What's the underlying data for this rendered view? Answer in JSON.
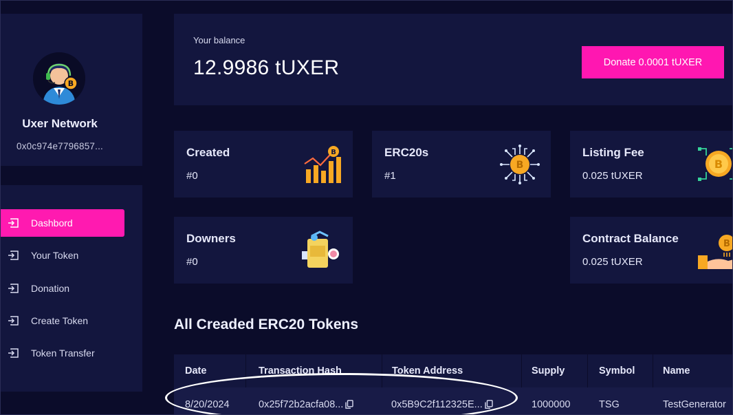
{
  "profile": {
    "name": "Uxer Network",
    "address": "0x0c974e7796857..."
  },
  "nav": {
    "items": [
      {
        "label": "Dashbord",
        "active": true
      },
      {
        "label": "Your Token",
        "active": false
      },
      {
        "label": "Donation",
        "active": false
      },
      {
        "label": "Create Token",
        "active": false
      },
      {
        "label": "Token Transfer",
        "active": false
      }
    ]
  },
  "balance": {
    "label": "Your balance",
    "value": "12.9986 tUXER",
    "donate_label": "Donate 0.0001 tUXER"
  },
  "stats": {
    "created": {
      "title": "Created",
      "value": "#0",
      "icon": "growth-chart-icon"
    },
    "erc20s": {
      "title": "ERC20s",
      "value": "#1",
      "icon": "bitcoin-circuit-icon"
    },
    "listing_fee": {
      "title": "Listing Fee",
      "value": "0.025 tUXER",
      "icon": "coin-network-icon"
    },
    "owners": {
      "title": "Downers",
      "value": "#0",
      "icon": "wallet-icon"
    },
    "contract_balance": {
      "title": "Contract Balance",
      "value": "0.025 tUXER",
      "icon": "hand-coin-icon"
    }
  },
  "tokens": {
    "title": "All Creaded ERC20 Tokens",
    "columns": [
      "Date",
      "Transaction Hash",
      "Token Address",
      "Supply",
      "Symbol",
      "Name"
    ],
    "rows": [
      {
        "date": "8/20/2024",
        "tx_hash": "0x25f72b2acfa08...",
        "token_address": "0x5B9C2f112325E...",
        "supply": "1000000",
        "symbol": "TSG",
        "name": "TestGenerator"
      }
    ]
  },
  "colors": {
    "background": "#0b0c2a",
    "card": "#13163e",
    "accent": "#ff17b1",
    "coin": "#f7a823"
  }
}
